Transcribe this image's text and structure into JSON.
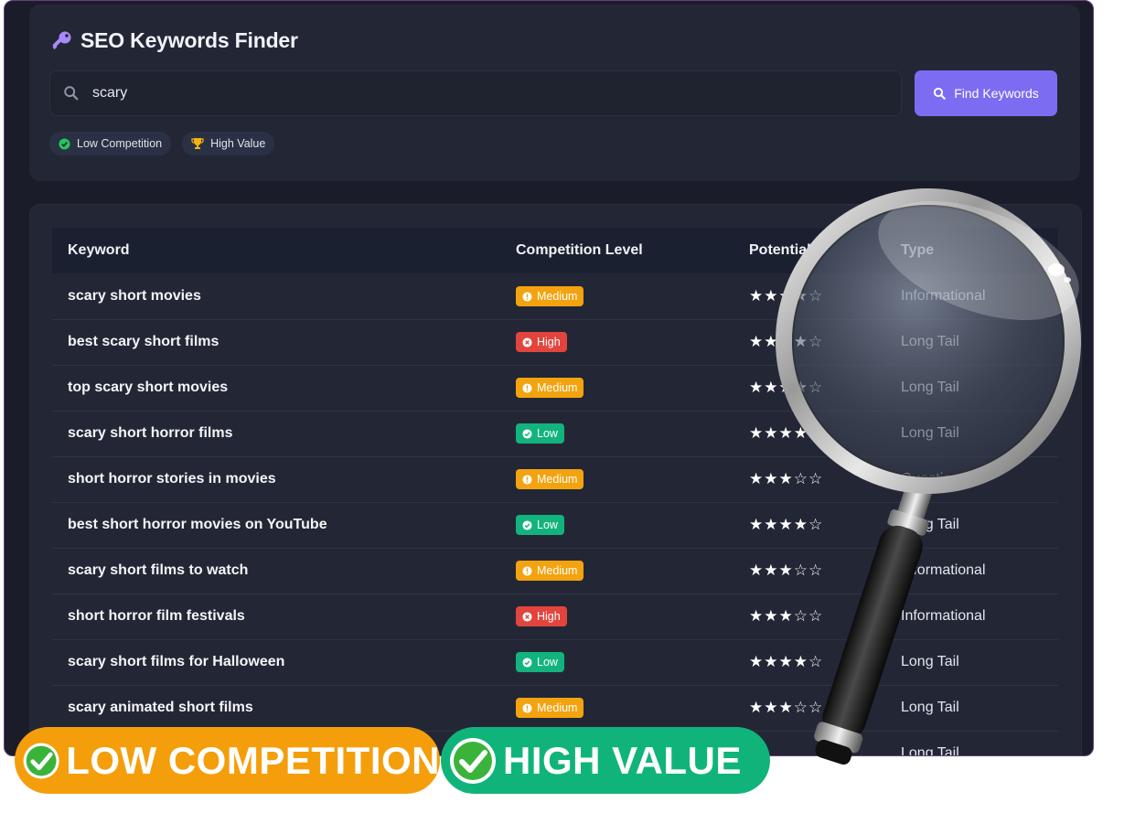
{
  "app": {
    "title": "SEO Keywords Finder",
    "title_icon": "key-icon"
  },
  "search": {
    "value": "scary",
    "placeholder": "",
    "button_label": "Find Keywords"
  },
  "filters": [
    {
      "label": "Low Competition",
      "icon": "check-circle-icon"
    },
    {
      "label": "High Value",
      "icon": "trophy-icon"
    }
  ],
  "table": {
    "headers": {
      "keyword": "Keyword",
      "competition": "Competition Level",
      "potential": "Potential",
      "type": "Type"
    },
    "rows": [
      {
        "keyword": "scary short movies",
        "competition": "Medium",
        "stars": "★★★★☆",
        "type": "Informational"
      },
      {
        "keyword": "best scary short films",
        "competition": "High",
        "stars": "★★★★☆",
        "type": "Long Tail"
      },
      {
        "keyword": "top scary short movies",
        "competition": "Medium",
        "stars": "★★★★☆",
        "type": "Long Tail"
      },
      {
        "keyword": "scary short horror films",
        "competition": "Low",
        "stars": "★★★★☆",
        "type": "Long Tail"
      },
      {
        "keyword": "short horror stories in movies",
        "competition": "Medium",
        "stars": "★★★☆☆",
        "type": "Question"
      },
      {
        "keyword": "best short horror movies on YouTube",
        "competition": "Low",
        "stars": "★★★★☆",
        "type": "Long Tail"
      },
      {
        "keyword": "scary short films to watch",
        "competition": "Medium",
        "stars": "★★★☆☆",
        "type": "Informational"
      },
      {
        "keyword": "short horror film festivals",
        "competition": "High",
        "stars": "★★★☆☆",
        "type": "Informational"
      },
      {
        "keyword": "scary short films for Halloween",
        "competition": "Low",
        "stars": "★★★★☆",
        "type": "Long Tail"
      },
      {
        "keyword": "scary animated short films",
        "competition": "Medium",
        "stars": "★★★☆☆",
        "type": "Long Tail"
      },
      {
        "keyword": "",
        "competition": "",
        "stars": "",
        "type": "Long Tail"
      }
    ]
  },
  "banners": [
    {
      "label": "LOW COMPETITION",
      "icon": "check-badge-icon",
      "color": "#f59e0b"
    },
    {
      "label": "HIGH VALUE",
      "icon": "check-badge-icon",
      "color": "#10b47a"
    }
  ],
  "colors": {
    "accent": "#7c6cf2",
    "medium": "#f2a30f",
    "high": "#e2453d",
    "low": "#12b37c"
  }
}
